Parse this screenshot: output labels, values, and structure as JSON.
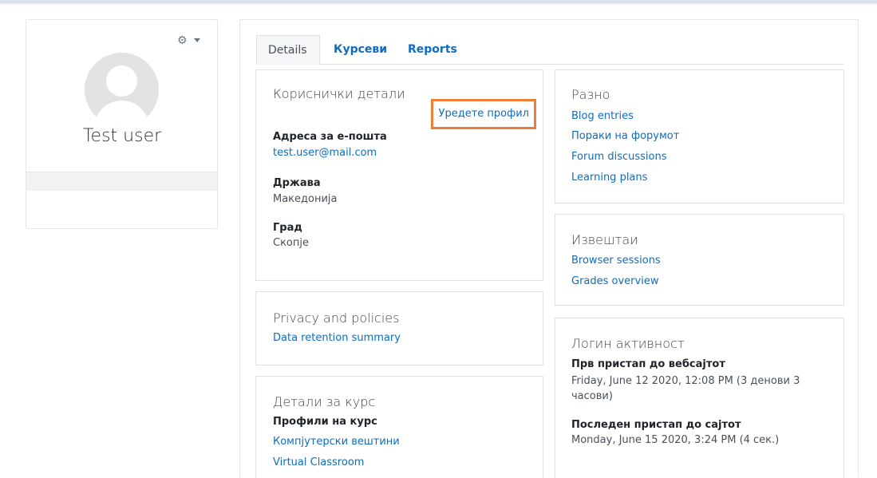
{
  "profile": {
    "user_name": "Test user",
    "settings_icon": "gear-icon"
  },
  "tabs": [
    {
      "label": "Details",
      "active": true
    },
    {
      "label": "Курсеви",
      "active": false
    },
    {
      "label": "Reports",
      "active": false
    }
  ],
  "user_details": {
    "title": "Кориснички детали",
    "edit_link": "Уредете профил",
    "email_label": "Адреса за е-пошта",
    "email_value": "test.user@mail.com",
    "country_label": "Држава",
    "country_value": "Македонија",
    "city_label": "Град",
    "city_value": "Скопје"
  },
  "privacy": {
    "title": "Privacy and policies",
    "link": "Data retention summary"
  },
  "course_details": {
    "title": "Детали за курс",
    "profiles_label": "Профили на курс",
    "courses": [
      "Компјутерски вештини",
      "Virtual Classroom"
    ]
  },
  "misc": {
    "title": "Разно",
    "links": [
      "Blog entries",
      "Пораки на форумот",
      "Forum discussions",
      "Learning plans"
    ]
  },
  "reports": {
    "title": "Извештаи",
    "links": [
      "Browser sessions",
      "Grades overview"
    ]
  },
  "login_activity": {
    "title": "Логин активност",
    "first_access_label": "Прв пристап до вебсајтот",
    "first_access_value": "Friday, June 12 2020, 12:08 PM  (3 денови 3 часови)",
    "last_access_label": "Последен пристап до сајтот",
    "last_access_value": "Monday, June 15 2020, 3:24 PM  (4 сек.)"
  },
  "colors": {
    "link": "#0f6cbf",
    "highlight_border": "#ee7d3b"
  }
}
